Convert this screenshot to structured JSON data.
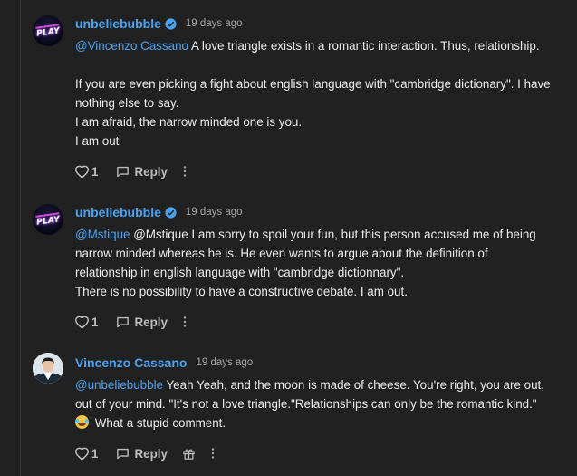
{
  "comments": [
    {
      "author": "unbeliebubble",
      "verified": true,
      "time": "19 days ago",
      "avatar_text": "PLAY",
      "lines": [
        {
          "mention": "@Vincenzo Cassano",
          "text": " A love triangle exists in a romantic interaction. Thus, relationship."
        },
        {
          "mention": "",
          "text": ""
        },
        {
          "mention": "",
          "text": "If you are even picking a fight about english language with \"cambridge dictionary\". I have"
        },
        {
          "mention": "",
          "text": "nothing else to say."
        },
        {
          "mention": "",
          "text": "I am afraid, the narrow minded one is you."
        },
        {
          "mention": "",
          "text": "I am out"
        }
      ],
      "likes": "1",
      "reply_label": "Reply"
    },
    {
      "author": "unbeliebubble",
      "verified": true,
      "time": "19 days ago",
      "avatar_text": "PLAY",
      "lines": [
        {
          "mention": "@Mstique",
          "text": " @Mstique I am sorry to spoil your fun, but this person accused me of being"
        },
        {
          "mention": "",
          "text": "narrow minded whereas he is. He even wants to argue about the definition of"
        },
        {
          "mention": "",
          "text": "relationship in english language with \"cambridge dictionnary\"."
        },
        {
          "mention": "",
          "text": "There is no possibility to have a constructive debate. I am out."
        }
      ],
      "likes": "1",
      "reply_label": "Reply"
    },
    {
      "author": "Vincenzo Cassano",
      "verified": false,
      "time": "19 days ago",
      "lines": [
        {
          "mention": "@unbeliebubble",
          "text": " Yeah Yeah, and the moon is made of cheese. You're right, you are out,"
        },
        {
          "mention": "",
          "text": "out of your mind. \"It's not a love triangle.\"Relationships can only be the romantic kind.\""
        },
        {
          "mention": "",
          "text": " What a stupid comment.",
          "emoji": "joy-emoji"
        }
      ],
      "likes": "1",
      "reply_label": "Reply"
    }
  ],
  "colors": {
    "background": "#212121",
    "accent": "#4aa3f0",
    "muted": "#a7a7a7"
  }
}
